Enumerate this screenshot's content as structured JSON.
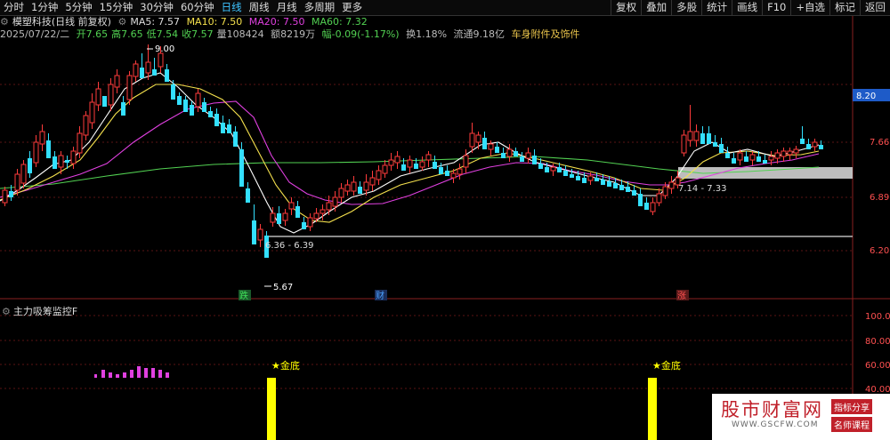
{
  "toolbar": {
    "periods": [
      "分时",
      "1分钟",
      "5分钟",
      "15分钟",
      "30分钟",
      "60分钟",
      "日线",
      "周线",
      "月线",
      "多周期",
      "更多"
    ],
    "active_period": "日线",
    "right_buttons": [
      "复权",
      "叠加",
      "多股",
      "统计",
      "画线",
      "F10",
      "+自选",
      "标记",
      "返回"
    ]
  },
  "stock": {
    "name": "模塑科技(日线 前复权)",
    "ma5": "MA5: 7.57",
    "ma10": "MA10: 7.50",
    "ma20": "MA20: 7.50",
    "ma60": "MA60: 7.32",
    "date": "2025/07/22/二",
    "open": "开7.65",
    "high": "高7.65",
    "low": "低7.54",
    "close": "收7.57",
    "volume": "量108424",
    "amount": "额8219万",
    "change": "幅-0.09(-1.17%)",
    "turnover": "换1.18%",
    "float": "流通9.18亿",
    "sector": "车身附件及饰件"
  },
  "price_axis": {
    "ticks": [
      "7.66",
      "6.89",
      "6.20"
    ],
    "current_price": "8.20"
  },
  "annotations": {
    "high_label": "9.00",
    "low_label": "5.67",
    "zone1": "6.36 - 6.39",
    "zone2": "7.14 - 7.33",
    "marker_die": "跌",
    "marker_cai": "财",
    "marker_zhang": "涨"
  },
  "indicator": {
    "title": "主力吸筹监控F",
    "signal1": "★金底",
    "signal2": "★金底",
    "axis_ticks": [
      "100.00",
      "80.00",
      "60.00",
      "40.00"
    ]
  },
  "colors": {
    "up": "#ff3b3b",
    "down": "#33e0ff",
    "ma5": "#ffffff",
    "ma10": "#f4e04d",
    "ma20": "#e040e0",
    "ma60": "#52d152",
    "signal": "#ffff00"
  },
  "watermark": {
    "main": "股市财富网",
    "url": "WWW.GSCFW.COM",
    "tag1": "指标分享",
    "tag2": "名师课程"
  }
}
